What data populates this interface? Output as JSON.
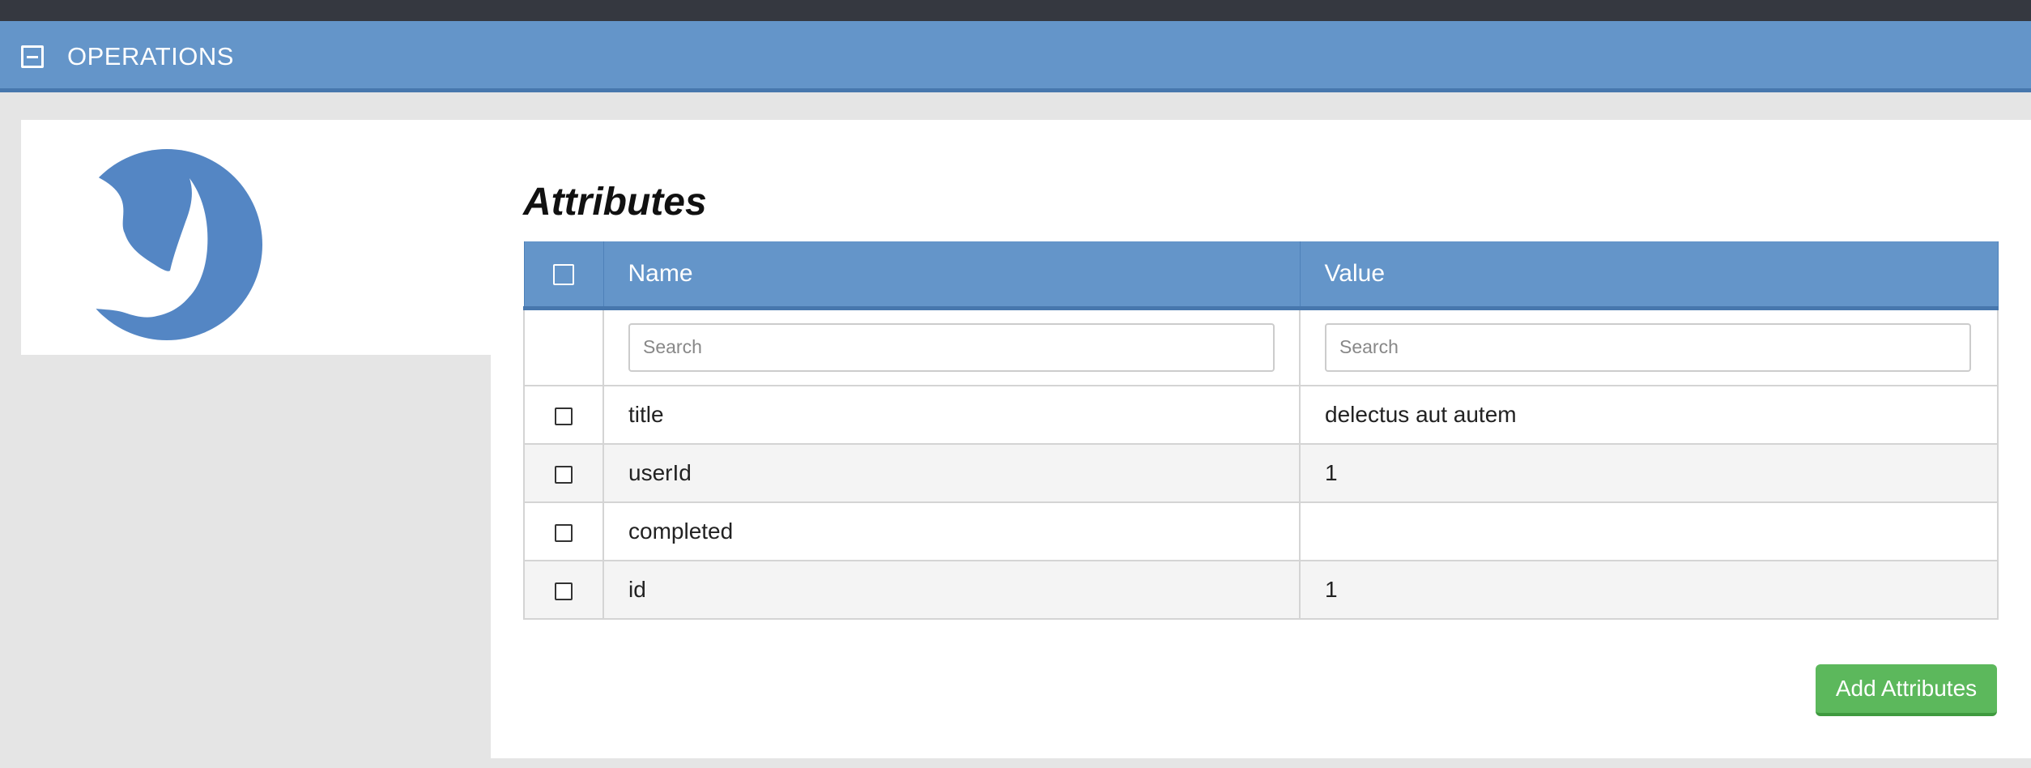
{
  "header": {
    "title": "OPERATIONS",
    "collapse_icon": "minus-square-icon",
    "colors": {
      "bar": "#6495c9",
      "top_strip": "#353840"
    }
  },
  "logo": {
    "icon": "rhino-logo-icon",
    "color": "#5486c4"
  },
  "attributes": {
    "heading": "Attributes",
    "columns": [
      "Name",
      "Value"
    ],
    "search_placeholders": {
      "name": "Search",
      "value": "Search"
    },
    "rows": [
      {
        "name": "title",
        "value": "delectus aut autem"
      },
      {
        "name": "userId",
        "value": "1"
      },
      {
        "name": "completed",
        "value": ""
      },
      {
        "name": "id",
        "value": "1"
      }
    ],
    "add_button_label": "Add Attributes",
    "add_button_color": "#5cb85c"
  }
}
